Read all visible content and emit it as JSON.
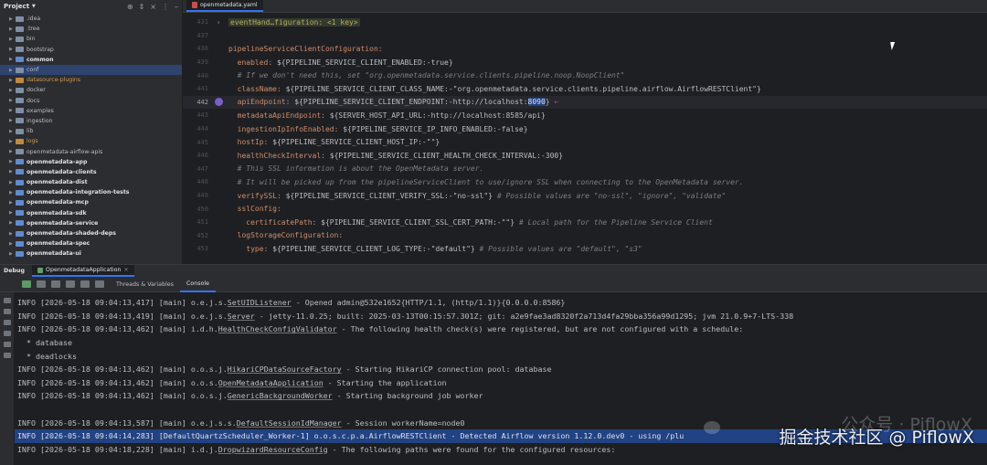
{
  "project": {
    "title": "Project",
    "items": [
      {
        "label": ".idea",
        "type": "folder"
      },
      {
        "label": ".tree",
        "type": "folder"
      },
      {
        "label": "bin",
        "type": "folder"
      },
      {
        "label": "bootstrap",
        "type": "folder"
      },
      {
        "label": "common",
        "type": "module"
      },
      {
        "label": "conf",
        "type": "folder",
        "selected": true
      },
      {
        "label": "datasource-plugins",
        "type": "folder-orange"
      },
      {
        "label": "docker",
        "type": "folder"
      },
      {
        "label": "docs",
        "type": "folder"
      },
      {
        "label": "examples",
        "type": "folder"
      },
      {
        "label": "ingestion",
        "type": "folder"
      },
      {
        "label": "lib",
        "type": "folder"
      },
      {
        "label": "logs",
        "type": "folder-orange"
      },
      {
        "label": "openmetadata-airflow-apis",
        "type": "folder"
      },
      {
        "label": "openmetadata-app",
        "type": "module"
      },
      {
        "label": "openmetadata-clients",
        "type": "module"
      },
      {
        "label": "openmetadata-dist",
        "type": "module"
      },
      {
        "label": "openmetadata-integration-tests",
        "type": "module"
      },
      {
        "label": "openmetadata-mcp",
        "type": "module"
      },
      {
        "label": "openmetadata-sdk",
        "type": "module"
      },
      {
        "label": "openmetadata-service",
        "type": "module"
      },
      {
        "label": "openmetadata-shaded-deps",
        "type": "module"
      },
      {
        "label": "openmetadata-spec",
        "type": "module"
      },
      {
        "label": "openmetadata-ui",
        "type": "module"
      }
    ]
  },
  "editor": {
    "tab_label": "openmetadata.yaml",
    "lines": [
      {
        "n": "431",
        "fold": "eventHand…figuration: <1 key>"
      },
      {
        "n": "437",
        "text": ""
      },
      {
        "n": "438",
        "key": "pipelineServiceClientConfiguration:",
        "indent": ""
      },
      {
        "n": "439",
        "key": "enabled:",
        "val": " ${PIPELINE_SERVICE_CLIENT_ENABLED:-true}",
        "indent": "  "
      },
      {
        "n": "440",
        "comment": "# If we don't need this, set \"org.openmetadata.service.clients.pipeline.noop.NoopClient\"",
        "indent": "  "
      },
      {
        "n": "441",
        "key": "className:",
        "val": " ${PIPELINE_SERVICE_CLIENT_CLASS_NAME:-\"org.openmetadata.service.clients.pipeline.airflow.AirflowRESTClient\"}",
        "indent": "  "
      },
      {
        "n": "442",
        "key": "apiEndpoint:",
        "val_pre": " ${PIPELINE_SERVICE_CLIENT_ENDPOINT:-http://localhost:",
        "val_hl": "8090",
        "val_post": "}",
        "indent": "  ",
        "current": true
      },
      {
        "n": "443",
        "key": "metadataApiEndpoint:",
        "val": " ${SERVER_HOST_API_URL:-http://localhost:8585/api}",
        "indent": "  "
      },
      {
        "n": "444",
        "key": "ingestionIpInfoEnabled:",
        "val": " ${PIPELINE_SERVICE_IP_INFO_ENABLED:-false}",
        "indent": "  "
      },
      {
        "n": "445",
        "key": "hostIp:",
        "val": " ${PIPELINE_SERVICE_CLIENT_HOST_IP:-\"\"}",
        "indent": "  "
      },
      {
        "n": "446",
        "key": "healthCheckInterval:",
        "val": " ${PIPELINE_SERVICE_CLIENT_HEALTH_CHECK_INTERVAL:-300}",
        "indent": "  "
      },
      {
        "n": "447",
        "comment": "# This SSL information is about the OpenMetadata server.",
        "indent": "  "
      },
      {
        "n": "448",
        "comment": "# It will be picked up from the pipelineServiceClient to use/ignore SSL when connecting to the OpenMetadata server.",
        "indent": "  "
      },
      {
        "n": "449",
        "key": "verifySSL:",
        "val": " ${PIPELINE_SERVICE_CLIENT_VERIFY_SSL:-\"no-ssl\"}",
        "comment_after": " # Possible values are \"no-ssl\", \"ignore\", \"validate\"",
        "indent": "  "
      },
      {
        "n": "450",
        "key": "sslConfig:",
        "indent": "  "
      },
      {
        "n": "451",
        "key": "certificatePath:",
        "val": " ${PIPELINE_SERVICE_CLIENT_SSL_CERT_PATH:-\"\"}",
        "comment_after": " # Local path for the Pipeline Service Client",
        "indent": "    "
      },
      {
        "n": "452",
        "key": "logStorageConfiguration:",
        "indent": "  "
      },
      {
        "n": "453",
        "key": "type:",
        "val": " ${PIPELINE_SERVICE_CLIENT_LOG_TYPE:-\"default\"}",
        "comment_after": " # Possible values are \"default\", \"s3\"",
        "indent": "    "
      }
    ]
  },
  "debug": {
    "title": "Debug",
    "session_tab": "OpenmetadataApplication",
    "subtabs": [
      "Threads & Variables",
      "Console"
    ],
    "active_subtab": "Console",
    "logs": [
      {
        "pre": "INFO [2026-05-18 09:04:13,417] [main] o.e.j.s.",
        "cls": "SetUIDListener",
        "post": " - Opened admin@532e1652{HTTP/1.1, (http/1.1)}{0.0.0.0:8586}"
      },
      {
        "pre": "INFO [2026-05-18 09:04:13,419] [main] o.e.j.s.",
        "cls": "Server",
        "post": " - jetty-11.0.25; built: 2025-03-13T00:15:57.301Z; git: a2e9fae3ad8320f2a713d4fa29bba356a99d1295; jvm 21.0.9+7-LTS-338"
      },
      {
        "pre": "INFO [2026-05-18 09:04:13,462] [main] i.d.h.",
        "cls": "HealthCheckConfigValidator",
        "post": " - The following health check(s) were registered, but are not configured with a schedule:"
      },
      {
        "pre": "  * database",
        "cls": "",
        "post": ""
      },
      {
        "pre": "  * deadlocks",
        "cls": "",
        "post": ""
      },
      {
        "pre": "INFO [2026-05-18 09:04:13,462] [main] o.o.s.j.",
        "cls": "HikariCPDataSourceFactory",
        "post": " - Starting HikariCP connection pool: database"
      },
      {
        "pre": "INFO [2026-05-18 09:04:13,462] [main] o.o.s.",
        "cls": "OpenMetadataApplication",
        "post": " - Starting the application"
      },
      {
        "pre": "INFO [2026-05-18 09:04:13,462] [main] o.o.s.j.",
        "cls": "GenericBackgroundWorker",
        "post": " - Starting background job worker"
      },
      {
        "pre": "",
        "cls": "",
        "post": ""
      },
      {
        "pre": "INFO [2026-05-18 09:04:13,587] [main] o.e.j.s.s.",
        "cls": "DefaultSessionIdManager",
        "post": " - Session workerName=node0"
      },
      {
        "pre": "INFO [2026-05-18 09:04:14,283] [DefaultQuartzScheduler_Worker-1] o.o.s.c.p.a.AirflowRESTClient - Detected Airflow version 1.12.0.dev0 - using /plu",
        "cls": "",
        "post": "",
        "selected": true
      },
      {
        "pre": "INFO [2026-05-18 09:04:18,228] [main] i.d.j.",
        "cls": "DropwizardResourceConfig",
        "post": " - The following paths were found for the configured resources:"
      }
    ]
  },
  "watermark": {
    "text": "掘金技术社区 @ PiflowX",
    "ghost": "公众号 · PiflowX"
  },
  "colors": {
    "accent": "#3574f0",
    "selection": "#214283",
    "key": "#cf8e6d",
    "string": "#6aab73",
    "comment": "#7a7e85"
  }
}
